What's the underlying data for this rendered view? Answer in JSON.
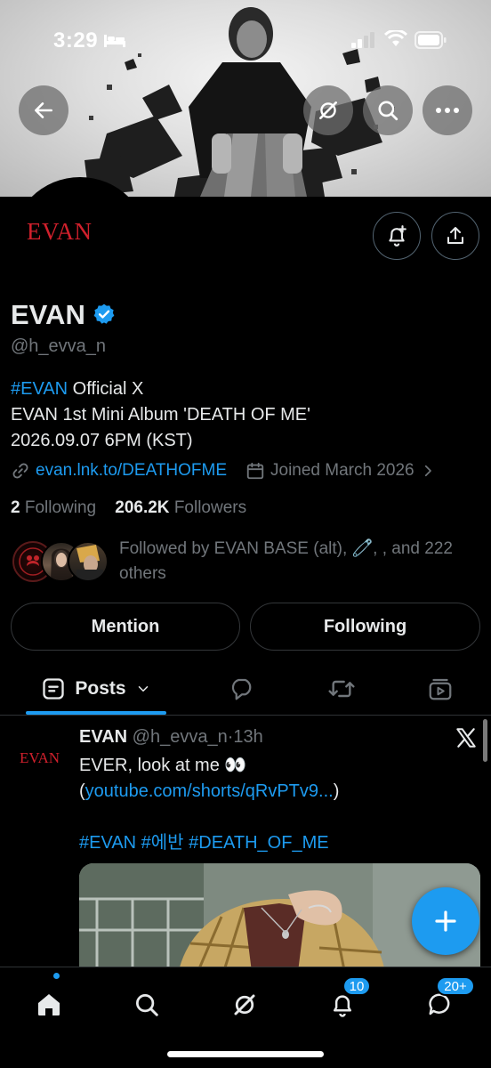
{
  "status_bar": {
    "time": "3:29"
  },
  "profile": {
    "name": "EVAN",
    "handle": "@h_evva_n",
    "avatar_logo_text": "EVAN",
    "bio_hashtag": "#EVAN",
    "bio_line1_rest": " Official X",
    "bio_line2": "EVAN 1st Mini Album 'DEATH OF ME'",
    "bio_line3": "2026.09.07 6PM (KST)",
    "link": "evan.lnk.to/DEATHOFME",
    "joined": "Joined March 2026",
    "following_count": "2",
    "following_label": "Following",
    "followers_count": "206.2K",
    "followers_label": "Followers",
    "followed_by_line1": "Followed by EVAN BASE (alt), 🧷, , and 222",
    "followed_by_line2": "others"
  },
  "buttons": {
    "mention": "Mention",
    "following": "Following"
  },
  "tabs": {
    "posts": "Posts"
  },
  "post": {
    "author": "EVAN",
    "handle": "@h_evva_n",
    "time": "·13h",
    "logo_text": "EVAN",
    "line1": "EVER, look at me 👀",
    "link_open": "(",
    "link": "youtube.com/shorts/qRvPTv9...",
    "link_close": ")",
    "hashtags": "#EVAN #에반 #DEATH_OF_ME"
  },
  "badges": {
    "notifications": "10",
    "messages": "20+"
  },
  "colors": {
    "accent": "#1d9bf0",
    "brand_red": "#d0202c",
    "muted": "#71767b",
    "background": "#000000"
  },
  "icons": [
    "back-arrow-icon",
    "grok-icon",
    "search-icon",
    "more-icon",
    "add-notification-icon",
    "share-icon",
    "verified-icon",
    "link-icon",
    "calendar-icon",
    "chevron-right-icon",
    "chevron-down-icon",
    "reply-icon",
    "repost-icon",
    "media-icon",
    "x-logo-icon",
    "plus-icon",
    "home-icon",
    "bell-icon",
    "messages-icon"
  ]
}
